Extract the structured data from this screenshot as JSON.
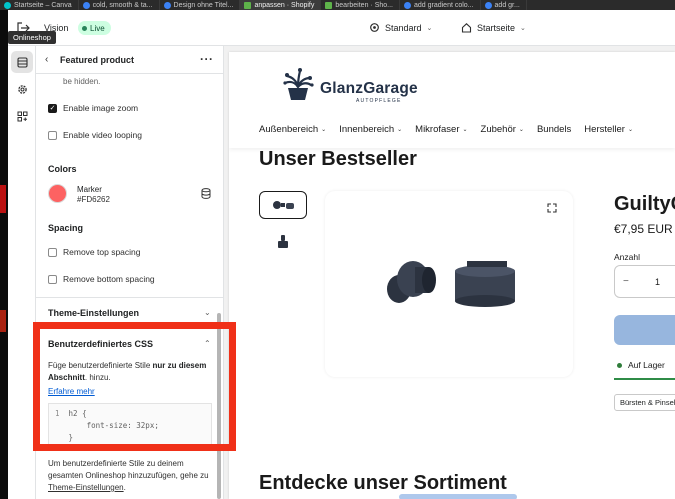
{
  "browser": {
    "tabs": [
      {
        "label": "Startseite – Canva",
        "icon": "canva-favicon",
        "active": false
      },
      {
        "label": "cold, smooth & ta...",
        "icon": "page-favicon",
        "active": false
      },
      {
        "label": "Design ohne Titel...",
        "icon": "page-favicon",
        "active": false
      },
      {
        "label": "anpassen · Shopify",
        "icon": "shopify-favicon",
        "active": true
      },
      {
        "label": "bearbeiten · Sho...",
        "icon": "shopify-favicon",
        "active": false
      },
      {
        "label": "add gradient colo...",
        "icon": "page-favicon",
        "active": false
      },
      {
        "label": "add gr...",
        "icon": "page-favicon",
        "active": false
      }
    ]
  },
  "topbar": {
    "theme_name": "Vision",
    "live_label": "Live",
    "tooltip": "Onlineshop",
    "device_label": "Standard",
    "page_label": "Startseite"
  },
  "panel": {
    "title": "Featured product",
    "hint_top": "be hidden.",
    "checkboxes": [
      {
        "label": "Enable image zoom",
        "checked": true
      },
      {
        "label": "Enable video looping",
        "checked": false
      }
    ],
    "colors_heading": "Colors",
    "color_name": "Marker",
    "color_value": "#FD6262",
    "spacing_heading": "Spacing",
    "spacing_checkboxes": [
      {
        "label": "Remove top spacing",
        "checked": false
      },
      {
        "label": "Remove bottom spacing",
        "checked": false
      }
    ],
    "theme_settings_heading": "Theme-Einstellungen",
    "css_heading": "Benutzerdefiniertes CSS",
    "css_desc_pre": "Füge benutzerdefinierte Stile ",
    "css_desc_bold": "nur zu diesem Abschnitt",
    "css_desc_post": ". hinzu.",
    "css_link": "Erfahre mehr",
    "code_lines": [
      {
        "num": "1",
        "text": "h2 {"
      },
      {
        "num": "",
        "text": "    font-size: 32px;"
      },
      {
        "num": "",
        "text": "}"
      }
    ],
    "bottom_note_pre": "Um benutzerdefinierte Stile zu deinem gesamten Onlineshop hinzuzufügen, gehe zu ",
    "bottom_note_link": "Theme-Einstellungen",
    "bottom_note_post": "."
  },
  "store": {
    "logo_text": "GlanzGarage",
    "logo_sub": "AUTOPFLEGE",
    "nav": [
      {
        "label": "Außenbereich",
        "dropdown": true
      },
      {
        "label": "Innenbereich",
        "dropdown": true
      },
      {
        "label": "Mikrofaser",
        "dropdown": true
      },
      {
        "label": "Zubehör",
        "dropdown": true
      },
      {
        "label": "Bundels",
        "dropdown": false
      },
      {
        "label": "Hersteller",
        "dropdown": true
      }
    ],
    "bestseller_heading": "Unser Bestseller",
    "product_title": "GuiltyG",
    "price": "€7,95 EUR",
    "qty_label": "Anzahl",
    "qty_minus": "−",
    "qty_value": "1",
    "qty_plus": "+",
    "stock_label": "Auf Lager",
    "chip_label": "Bürsten & Pinsel",
    "sortiment_heading": "Entdecke unser Sortiment"
  },
  "colors": {
    "highlight": "#f03018",
    "marker": "#FD6262",
    "live_bg": "#cdfee1",
    "cart_button": "#97b6de",
    "stock_green": "#2f8c47",
    "logo": "#243248"
  }
}
